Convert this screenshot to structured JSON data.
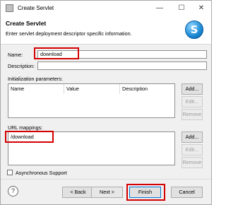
{
  "titlebar": {
    "title": "Create Servlet",
    "minimize": "—",
    "maximize": "☐",
    "close": "✕"
  },
  "banner": {
    "heading": "Create Servlet",
    "description": "Enter servlet deployment descriptor specific information.",
    "logo_letter": "S"
  },
  "form": {
    "name_label": "Name:",
    "name_value": "download",
    "description_label": "Description:",
    "description_value": "",
    "init_params_label": "Initialization parameters:",
    "init_params_columns": [
      "Name",
      "Value",
      "Description"
    ],
    "init_params_buttons": {
      "add": "Add...",
      "edit": "Edit...",
      "remove": "Remove"
    },
    "url_mappings_label": "URL mappings:",
    "url_mappings": [
      "/download"
    ],
    "url_buttons": {
      "add": "Add...",
      "edit": "Edit...",
      "remove": "Remove"
    },
    "async_label": "Asynchronous Support"
  },
  "footer": {
    "help": "?",
    "back": "< Back",
    "next": "Next >",
    "finish": "Finish",
    "cancel": "Cancel"
  },
  "colors": {
    "highlight": "#d40000",
    "logo": "#1a8ad4"
  }
}
